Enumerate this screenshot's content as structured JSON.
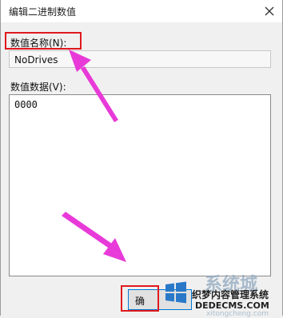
{
  "dialog": {
    "title": "编辑二进制数值",
    "value_name_label": "数值名称(N):",
    "value_name": "NoDrives",
    "value_data_label": "数值数据(V):",
    "value_data": "0000",
    "ok_label": "确"
  },
  "watermark": {
    "big_text": "系统城",
    "site_name": "织梦内容管理系统",
    "url": "DEDECMS.COM",
    "faint_text": "xitongcheng.com"
  },
  "colors": {
    "highlight": "#e0191c",
    "arrow": "#e83ad8",
    "focus_border": "#0078d7"
  },
  "icons": {
    "close": "close-icon",
    "arrow": "pink-arrow-icon",
    "logo": "windows-logo-icon"
  }
}
